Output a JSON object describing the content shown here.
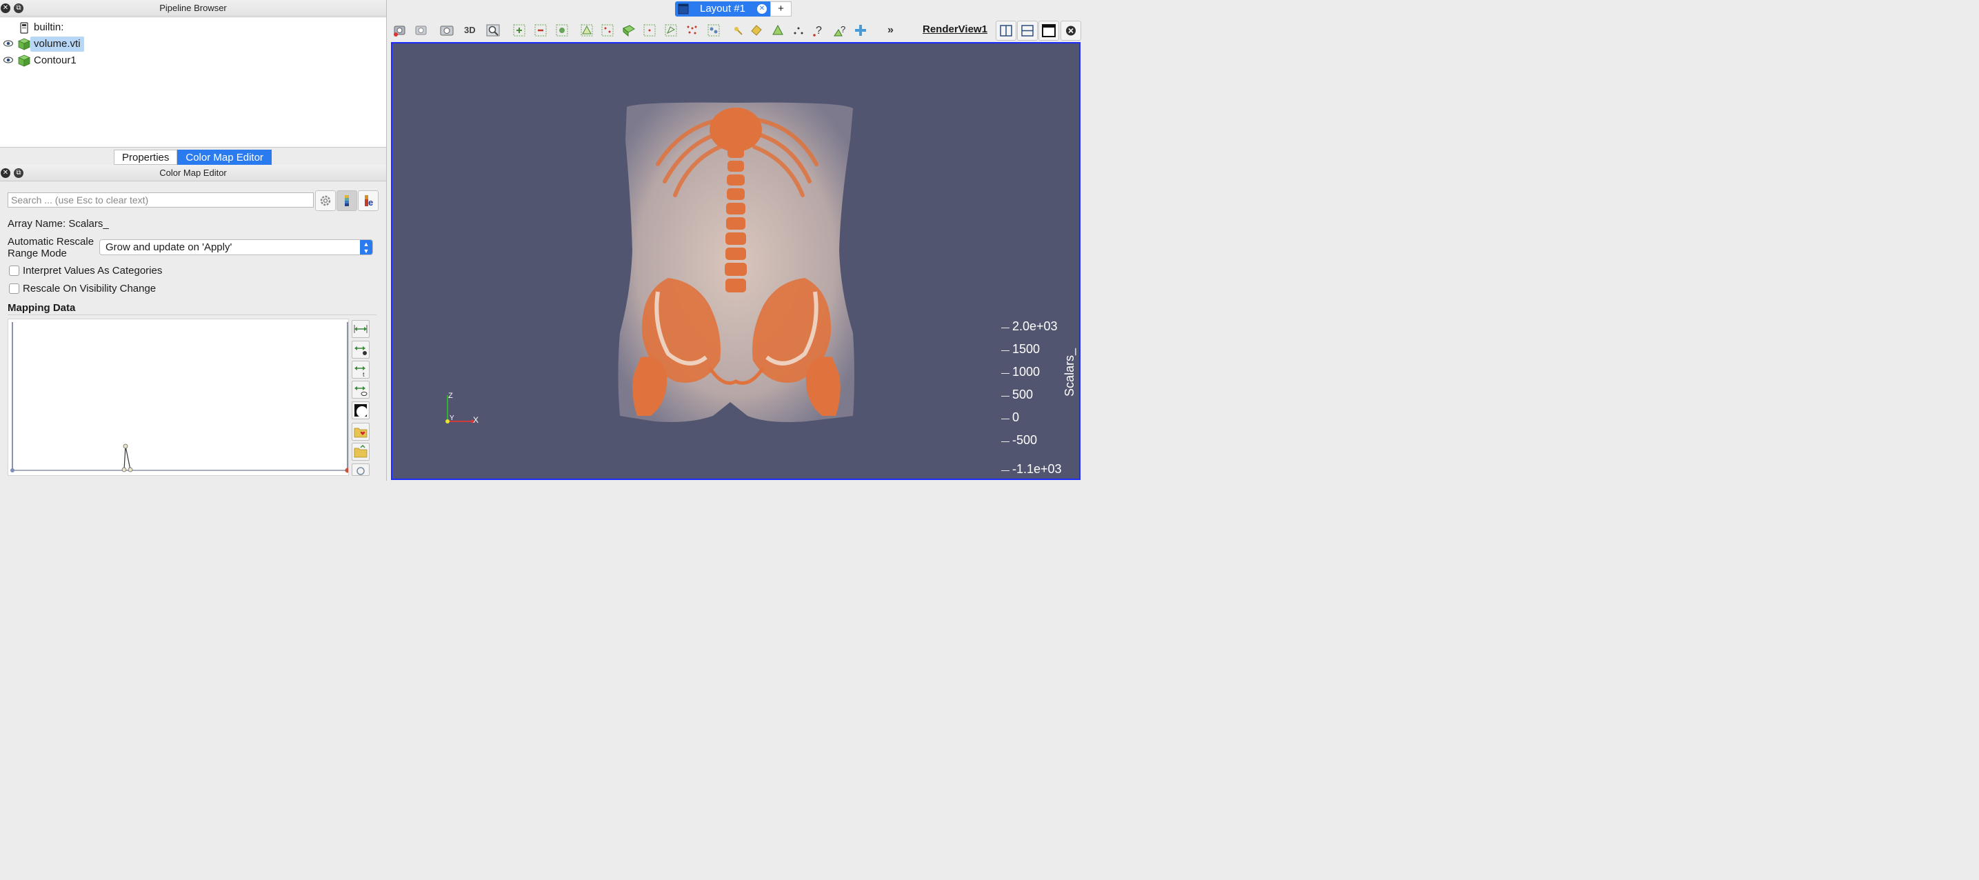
{
  "pipeline_browser": {
    "title": "Pipeline Browser",
    "items": [
      {
        "label": "builtin:"
      },
      {
        "label": "volume.vti"
      },
      {
        "label": "Contour1"
      }
    ]
  },
  "tabs": {
    "properties": "Properties",
    "color_map_editor": "Color Map Editor"
  },
  "color_map_editor": {
    "title": "Color Map Editor",
    "search_placeholder": "Search ... (use Esc to clear text)",
    "array_name": "Array Name: Scalars_",
    "rescale_label_line1": "Automatic Rescale",
    "rescale_label_line2": "Range Mode",
    "rescale_value": "Grow and update on 'Apply'",
    "interpret_categories": "Interpret Values As Categories",
    "rescale_visibility": "Rescale On Visibility Change",
    "mapping_data": "Mapping Data"
  },
  "layout": {
    "tab_label": "Layout #1",
    "add_label": "+",
    "view_name": "RenderView1",
    "toolbar_3d": "3D"
  },
  "scalar_bar": {
    "title": "Scalars_",
    "ticks": [
      "2.0e+03",
      "1500",
      "1000",
      "500",
      "0",
      "-500",
      "-1.1e+03"
    ]
  },
  "axes": {
    "z": "Z",
    "y": "Y",
    "x": "X"
  },
  "colors": {
    "accent": "#2b7bf0",
    "render_background": "#525570",
    "bone": "#e0733d"
  }
}
